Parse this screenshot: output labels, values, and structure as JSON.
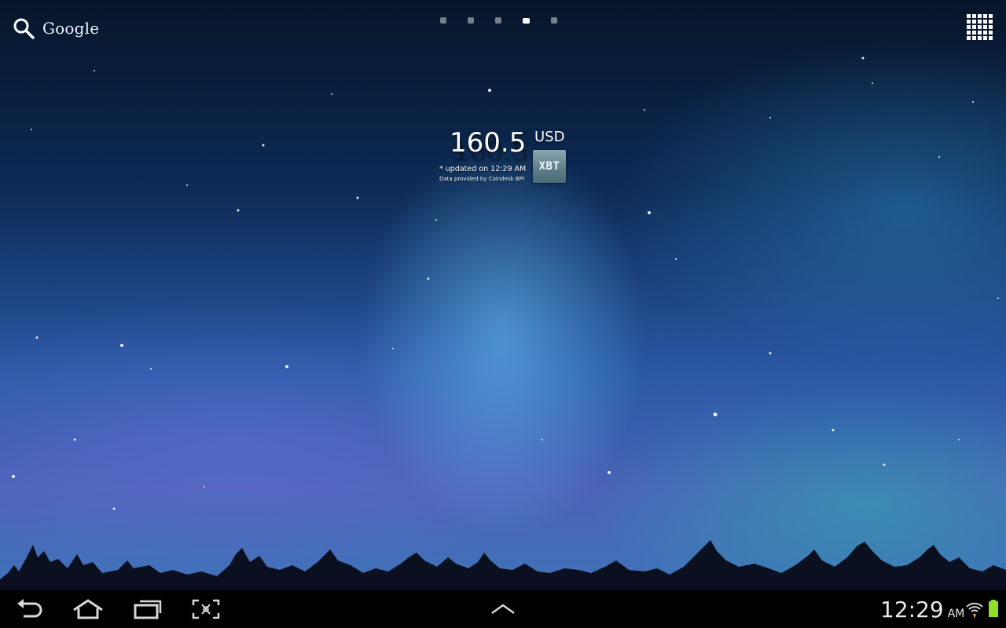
{
  "topbar": {
    "search_label": "Google",
    "search_icon": "search-icon",
    "page_indicator": {
      "count": 5,
      "active_index": 3
    },
    "apps_icon": "apps-grid-icon"
  },
  "widget": {
    "price": "160.5",
    "currency": "USD",
    "updated_text": "* updated on 12:29 AM",
    "provider_text": "Data provided by Coindesk BPI",
    "badge_label": "XBT"
  },
  "navbar": {
    "back_icon": "back-icon",
    "home_icon": "home-icon",
    "recent_icon": "recent-apps-icon",
    "screenshot_icon": "screenshot-icon",
    "up_icon": "chevron-up-icon",
    "clock_time": "12:29",
    "clock_ampm": "AM",
    "wifi_icon": "wifi-icon",
    "battery_icon": "battery-icon"
  },
  "colors": {
    "battery": "#8ee02a",
    "wifi_arrow": "#f0a020",
    "navbar_bg": "#000000"
  }
}
